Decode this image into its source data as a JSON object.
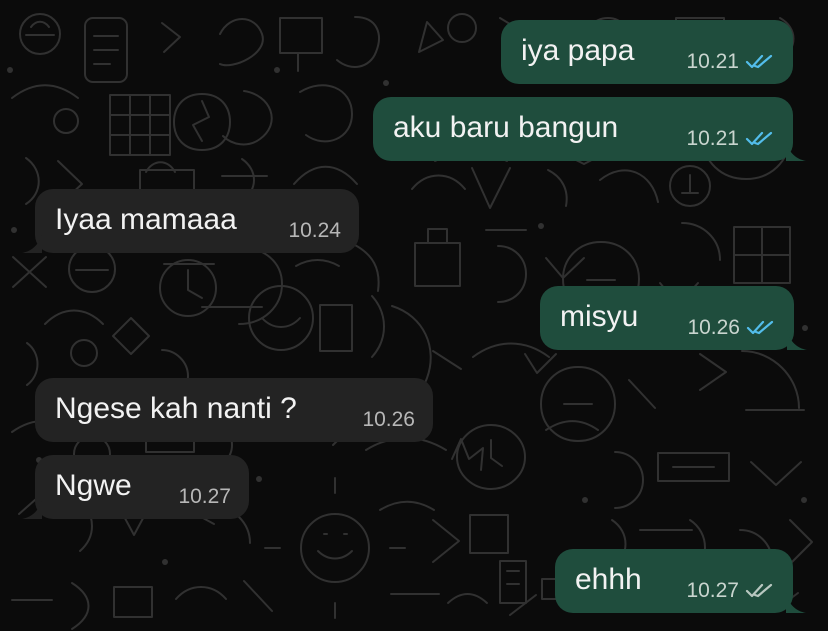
{
  "conversation": {
    "messages": [
      {
        "text": "iya papa",
        "time": "10.21",
        "direction": "outgoing",
        "status": "read"
      },
      {
        "text": "aku baru bangun",
        "time": "10.21",
        "direction": "outgoing",
        "status": "read"
      },
      {
        "text": "Iyaa mamaaa",
        "time": "10.24",
        "direction": "incoming"
      },
      {
        "text": "misyu",
        "time": "10.26",
        "direction": "outgoing",
        "status": "read"
      },
      {
        "text": "Ngese kah nanti ?",
        "time": "10.26",
        "direction": "incoming"
      },
      {
        "text": "Ngwe",
        "time": "10.27",
        "direction": "incoming"
      },
      {
        "text": "ehhh",
        "time": "10.27",
        "direction": "outgoing",
        "status": "delivered"
      }
    ]
  },
  "icons": {
    "read_receipt": "double-check-icon",
    "delivered_receipt": "double-check-icon"
  },
  "colors": {
    "background": "#0b0b0b",
    "outgoing_bubble": "#1f4d3d",
    "incoming_bubble": "#232323",
    "text": "#f2f2f2",
    "outgoing_meta": "#c9d5cf",
    "incoming_meta": "#b7b7b7",
    "read_tick": "#53bdeb",
    "delivered_tick": "#b8c7c0"
  }
}
